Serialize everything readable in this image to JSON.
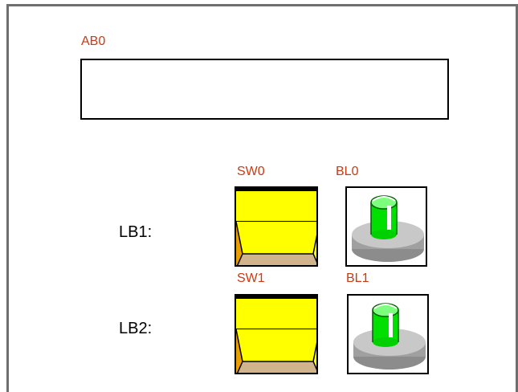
{
  "panel": {
    "display_tag": "AB0",
    "display_value": "",
    "rows": [
      {
        "row_label": "LB1:",
        "switch_tag": "SW0",
        "lamp_tag": "BL0",
        "lamp_state": "on",
        "lamp_color": "#00e000"
      },
      {
        "row_label": "LB2:",
        "switch_tag": "SW1",
        "lamp_tag": "BL1",
        "lamp_state": "on",
        "lamp_color": "#00e000"
      }
    ]
  },
  "colors": {
    "tag_text": "#c83a14",
    "switch_face": "#ffff00",
    "switch_base": "#d2b48c",
    "lamp_green": "#00e000",
    "lamp_base": "#a9a9a9"
  }
}
